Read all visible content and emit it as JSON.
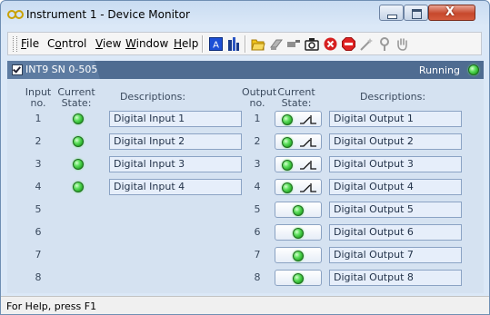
{
  "window": {
    "title": "Instrument 1 - Device Monitor"
  },
  "window_controls": {
    "close_glyph": "X"
  },
  "menu": [
    {
      "label": "File",
      "accel": "F",
      "rest": "ile"
    },
    {
      "label": "Control",
      "accel": "C",
      "rest": "ontrol"
    },
    {
      "label": "View",
      "accel": "V",
      "rest": "iew"
    },
    {
      "label": "Window",
      "accel": "W",
      "rest": "indow"
    },
    {
      "label": "Help",
      "accel": "H",
      "rest": "elp"
    }
  ],
  "toolbar_icons": [
    "font-icon",
    "chart-bars-icon",
    "folder-open-icon",
    "eraser-icon",
    "brush-icon",
    "camera-icon",
    "stop-x-icon",
    "stop-sign-icon",
    "wand-icon",
    "tool-icon",
    "hand-icon"
  ],
  "device_tab": {
    "label": "INT9 SN 0-505",
    "checked": true,
    "status": "Running",
    "status_color": "#2ecc40"
  },
  "headers": {
    "input_no": "Input no.",
    "input_state": "Current State:",
    "input_desc": "Descriptions:",
    "output_no": "Output no.",
    "output_state": "Current State:",
    "output_desc": "Descriptions:"
  },
  "inputs": [
    {
      "no": "1",
      "description": "Digital Input 1",
      "state": "on"
    },
    {
      "no": "2",
      "description": "Digital Input 2",
      "state": "on"
    },
    {
      "no": "3",
      "description": "Digital Input 3",
      "state": "on"
    },
    {
      "no": "4",
      "description": "Digital Input 4",
      "state": "on"
    },
    {
      "no": "5"
    },
    {
      "no": "6"
    },
    {
      "no": "7"
    },
    {
      "no": "8"
    }
  ],
  "outputs": [
    {
      "no": "1",
      "description": "Digital Output 1",
      "relay": true
    },
    {
      "no": "2",
      "description": "Digital Output 2",
      "relay": true
    },
    {
      "no": "3",
      "description": "Digital Output 3",
      "relay": true
    },
    {
      "no": "4",
      "description": "Digital Output 4",
      "relay": true
    },
    {
      "no": "5",
      "description": "Digital Output 5",
      "relay": false
    },
    {
      "no": "6",
      "description": "Digital Output 6",
      "relay": false
    },
    {
      "no": "7",
      "description": "Digital Output 7",
      "relay": false
    },
    {
      "no": "8",
      "description": "Digital Output 8",
      "relay": false
    }
  ],
  "statusbar": {
    "help_text": "For Help, press F1"
  },
  "colors": {
    "accent": "#4f6c91",
    "led_green": "#2ecc40",
    "panel_bg": "#d5e2f1"
  }
}
